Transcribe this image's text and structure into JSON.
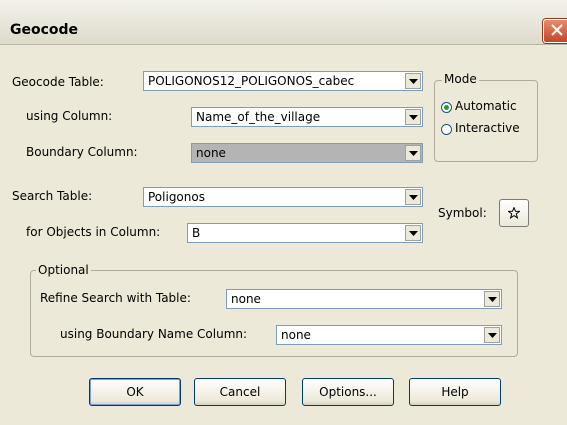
{
  "window": {
    "title": "Geocode"
  },
  "geocode_table": {
    "label": "Geocode Table:",
    "value": "POLIGONOS12_POLIGONOS_cabec"
  },
  "using_column": {
    "label": "using Column:",
    "value": "Name_of_the_village"
  },
  "boundary_column": {
    "label": "Boundary Column:",
    "value": "none"
  },
  "mode": {
    "title": "Mode",
    "automatic": "Automatic",
    "interactive": "Interactive",
    "selected": "Automatic"
  },
  "search_table": {
    "label": "Search Table:",
    "value": "Poligonos"
  },
  "objects_column": {
    "label": "for Objects in Column:",
    "value": "B"
  },
  "symbol": {
    "label": "Symbol:",
    "icon": "star-icon"
  },
  "optional": {
    "title": "Optional",
    "refine_label": "Refine Search with Table:",
    "refine_value": "none",
    "boundary_name_label": "using Boundary Name Column:",
    "boundary_name_value": "none"
  },
  "buttons": {
    "ok": "OK",
    "cancel": "Cancel",
    "options": "Options...",
    "help": "Help"
  }
}
